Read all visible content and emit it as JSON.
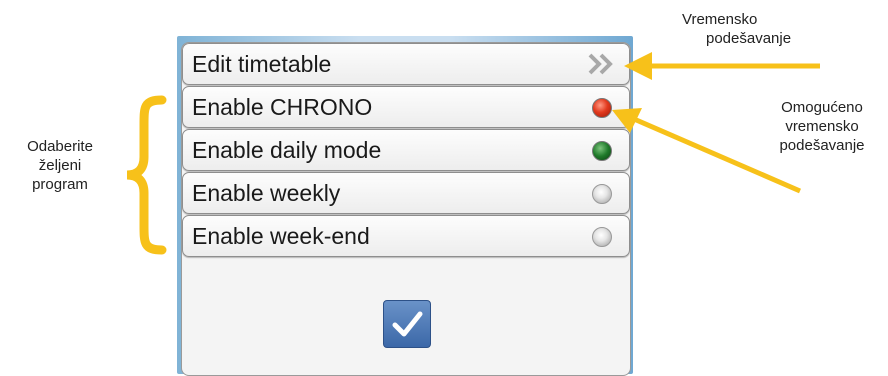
{
  "menu": {
    "items": [
      {
        "label": "Edit timetable",
        "indicator": "chevron-right"
      },
      {
        "label": "Enable CHRONO",
        "indicator": "red"
      },
      {
        "label": "Enable daily mode",
        "indicator": "green"
      },
      {
        "label": "Enable weekly",
        "indicator": "off"
      },
      {
        "label": "Enable week-end",
        "indicator": "off"
      }
    ],
    "confirm_icon": "check-icon"
  },
  "annotations": {
    "left_lines": [
      "Odaberite",
      "željeni",
      "program"
    ],
    "top_right_lines": [
      "Vremensko",
      "podešavanje"
    ],
    "mid_right_lines": [
      "Omogućeno",
      "vremensko",
      "podešavanje"
    ]
  },
  "colors": {
    "arrow": "#f7c11a",
    "led_red": "#e23a1e",
    "led_green": "#1f7a2a",
    "confirm_button": "#4a76b5"
  }
}
